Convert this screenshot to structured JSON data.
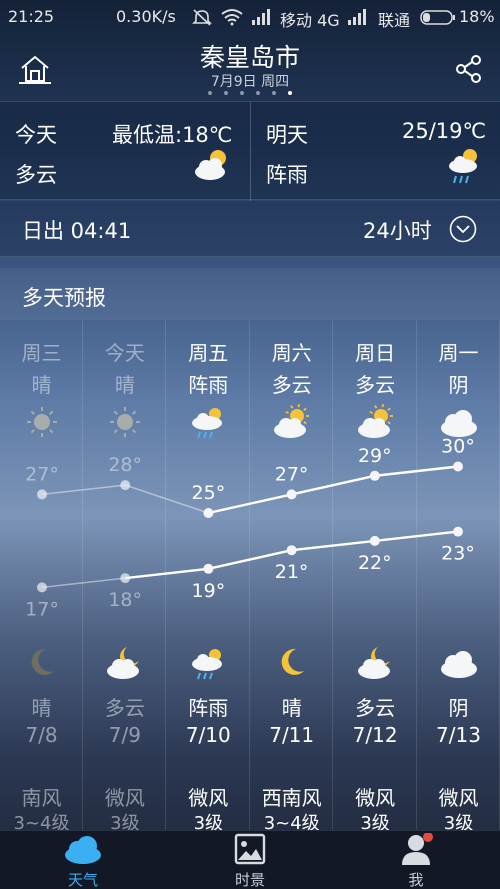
{
  "status_bar": {
    "time": "21:25",
    "speed": "0.30K/s",
    "network1": "移动 4G",
    "network2": "联通",
    "battery": "18%"
  },
  "header": {
    "city": "秦皇岛市",
    "date": "7月9日 周四",
    "page_count": 7,
    "current_page": 6
  },
  "today": {
    "label": "今天",
    "low_temp": "最低温:18℃",
    "condition": "多云",
    "icon": "partly-cloudy-icon"
  },
  "tomorrow": {
    "label": "明天",
    "temp_range": "25/19℃",
    "condition": "阵雨",
    "icon": "shower-icon"
  },
  "sunrise": {
    "text": "日出 04:41",
    "hourly_label": "24小时"
  },
  "forecast_title": "多天预报",
  "forecast": [
    {
      "day": "周三",
      "cond": "晴",
      "high": "27°",
      "low": "17°",
      "night_cond": "晴",
      "date": "7/8",
      "wind": "南风",
      "wind_level": "3~4级",
      "day_icon": "sun-icon",
      "night_icon": "moon-icon",
      "past": true
    },
    {
      "day": "今天",
      "cond": "晴",
      "high": "28°",
      "low": "18°",
      "night_cond": "多云",
      "date": "7/9",
      "wind": "微风",
      "wind_level": "3级",
      "day_icon": "sun-icon",
      "night_icon": "cloudy-moon-icon",
      "past": true
    },
    {
      "day": "周五",
      "cond": "阵雨",
      "high": "25°",
      "low": "19°",
      "night_cond": "阵雨",
      "date": "7/10",
      "wind": "微风",
      "wind_level": "3级",
      "day_icon": "shower-icon",
      "night_icon": "shower-icon",
      "past": false
    },
    {
      "day": "周六",
      "cond": "多云",
      "high": "27°",
      "low": "21°",
      "night_cond": "晴",
      "date": "7/11",
      "wind": "西南风",
      "wind_level": "3~4级",
      "day_icon": "partly-cloudy-icon",
      "night_icon": "moon-icon",
      "past": false
    },
    {
      "day": "周日",
      "cond": "多云",
      "high": "29°",
      "low": "22°",
      "night_cond": "多云",
      "date": "7/12",
      "wind": "微风",
      "wind_level": "3级",
      "day_icon": "partly-cloudy-icon",
      "night_icon": "cloudy-moon-icon",
      "past": false
    },
    {
      "day": "周一",
      "cond": "阴",
      "high": "30°",
      "low": "23°",
      "night_cond": "阴",
      "date": "7/13",
      "wind": "微风",
      "wind_level": "3级",
      "day_icon": "cloud-icon",
      "night_icon": "cloud-icon",
      "past": false
    }
  ],
  "chart_data": {
    "type": "line",
    "x": [
      "7/8",
      "7/9",
      "7/10",
      "7/11",
      "7/12",
      "7/13"
    ],
    "series": [
      {
        "values": [
          27,
          28,
          25,
          27,
          29,
          30
        ]
      },
      {
        "values": [
          17,
          18,
          19,
          21,
          22,
          23
        ]
      }
    ]
  },
  "tabs": [
    {
      "label": "天气",
      "icon": "cloud-tab-icon",
      "active": true
    },
    {
      "label": "时景",
      "icon": "picture-tab-icon",
      "active": false
    },
    {
      "label": "我",
      "icon": "user-tab-icon",
      "active": false,
      "badge": true
    }
  ],
  "colors": {
    "accent": "#3ab0f2",
    "badge": "#e24b3d"
  }
}
